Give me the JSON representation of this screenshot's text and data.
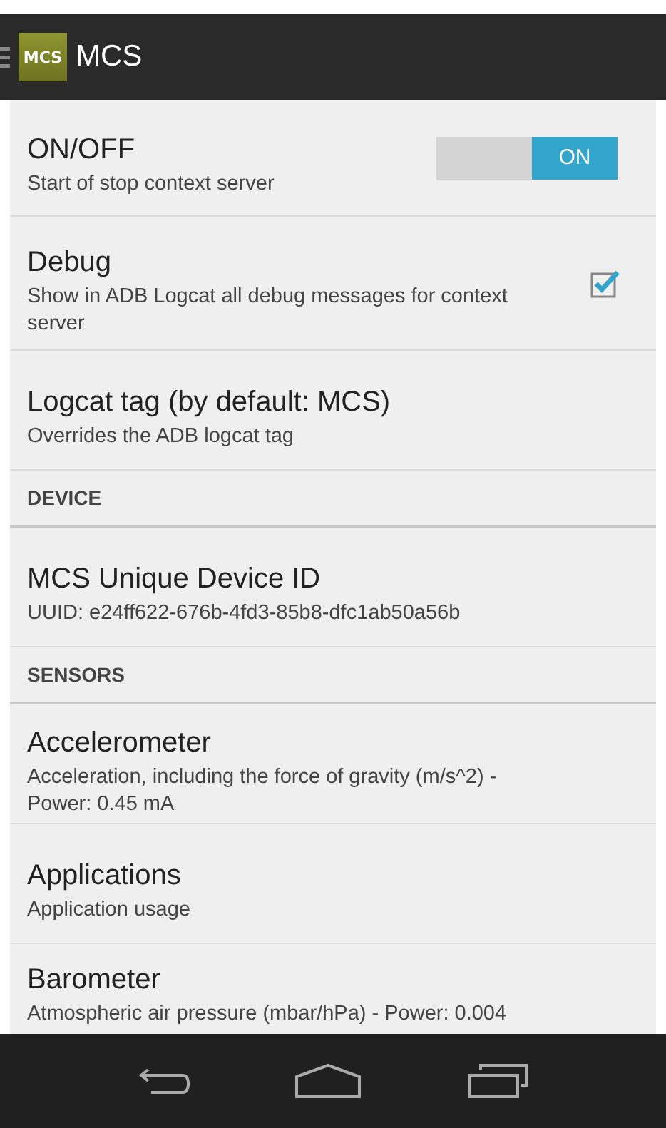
{
  "action_bar": {
    "logo": "MCS",
    "title": "MCS"
  },
  "items": [
    {
      "kind": "switch",
      "title": "ON/OFF",
      "summary": "Start of stop context server",
      "on": true,
      "switch_label": "ON"
    },
    {
      "kind": "checkbox",
      "title": "Debug",
      "summary": "Show in ADB Logcat all debug messages for context server",
      "checked": true
    },
    {
      "kind": "plain",
      "title": "Logcat tag (by default: MCS)",
      "summary": "Overrides the ADB logcat tag"
    },
    {
      "kind": "header",
      "title": "DEVICE"
    },
    {
      "kind": "plain",
      "title": "MCS Unique Device ID",
      "summary": "UUID: e24ff622-676b-4fd3-85b8-dfc1ab50a56b"
    },
    {
      "kind": "header",
      "title": "SENSORS"
    },
    {
      "kind": "plain",
      "title": "Accelerometer",
      "summary": "Acceleration, including the force of gravity (m/s^2)  - Power: 0.45 mA"
    },
    {
      "kind": "plain",
      "title": "Applications",
      "summary": "Application usage"
    },
    {
      "kind": "plain",
      "title": "Barometer",
      "summary": "Atmospheric air pressure (mbar/hPa)  - Power: 0.004"
    }
  ]
}
